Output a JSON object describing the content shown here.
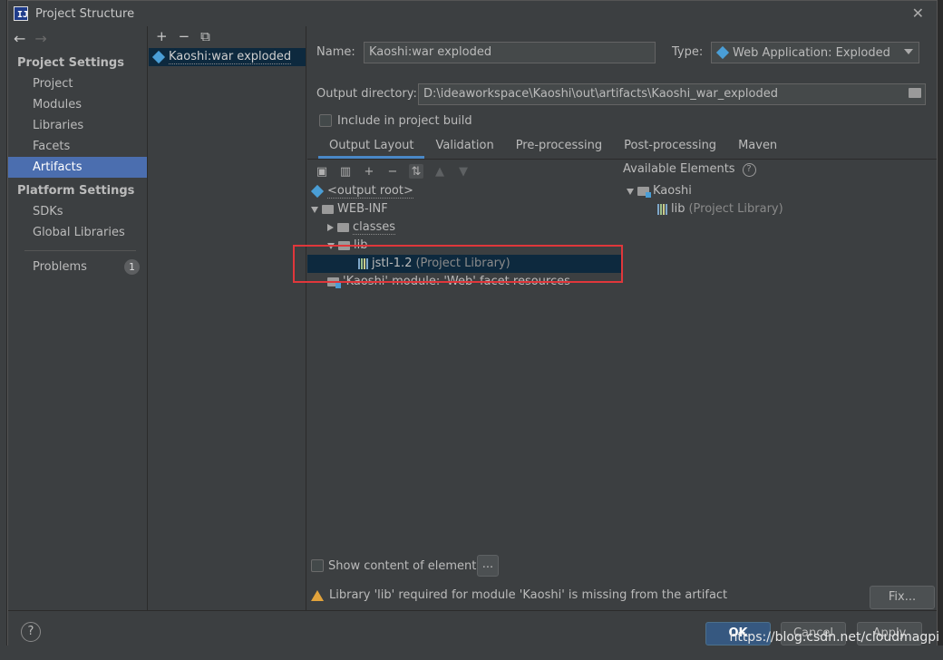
{
  "dialog": {
    "title": "Project Structure"
  },
  "sidebar": {
    "project_settings_header": "Project Settings",
    "project_settings": [
      {
        "label": "Project"
      },
      {
        "label": "Modules"
      },
      {
        "label": "Libraries"
      },
      {
        "label": "Facets"
      },
      {
        "label": "Artifacts"
      }
    ],
    "platform_settings_header": "Platform Settings",
    "platform_settings": [
      {
        "label": "SDKs"
      },
      {
        "label": "Global Libraries"
      }
    ],
    "problems": {
      "label": "Problems",
      "count": "1"
    }
  },
  "artifacts": {
    "items": [
      {
        "label": "Kaoshi:war exploded"
      }
    ]
  },
  "form": {
    "name_label": "Name:",
    "name_value": "Kaoshi:war exploded",
    "type_label": "Type:",
    "type_value": "Web Application: Exploded",
    "output_label": "Output directory:",
    "output_value": "D:\\ideaworkspace\\Kaoshi\\out\\artifacts\\Kaoshi_war_exploded",
    "include_build": "Include in project build"
  },
  "tabs": [
    {
      "label": "Output Layout"
    },
    {
      "label": "Validation"
    },
    {
      "label": "Pre-processing"
    },
    {
      "label": "Post-processing"
    },
    {
      "label": "Maven"
    }
  ],
  "tree": {
    "output_root": "<output root>",
    "web_inf": "WEB-INF",
    "classes": "classes",
    "lib": "lib",
    "jstl_name": "jstl-1.2",
    "jstl_note": "(Project Library)",
    "facet_resources": "'Kaoshi' module: 'Web' facet resources"
  },
  "available": {
    "header": "Available Elements",
    "module": "Kaoshi",
    "lib_name": "lib",
    "lib_note": "(Project Library)"
  },
  "footer": {
    "show_content": "Show content of elements",
    "dots_button": "...",
    "warning": "Library 'lib' required for module 'Kaoshi' is missing from the artifact",
    "fix_button": "Fix...",
    "ok_button": "OK",
    "cancel_button": "Cancel",
    "apply_button": "Apply",
    "help": "?"
  },
  "watermark": "https://blog.csdn.net/cloudmagpi",
  "colors": {
    "selection": "#4b6eaf",
    "tree_selection": "#0d293e",
    "highlight_box": "#e0373b",
    "primary_button": "#365880"
  }
}
